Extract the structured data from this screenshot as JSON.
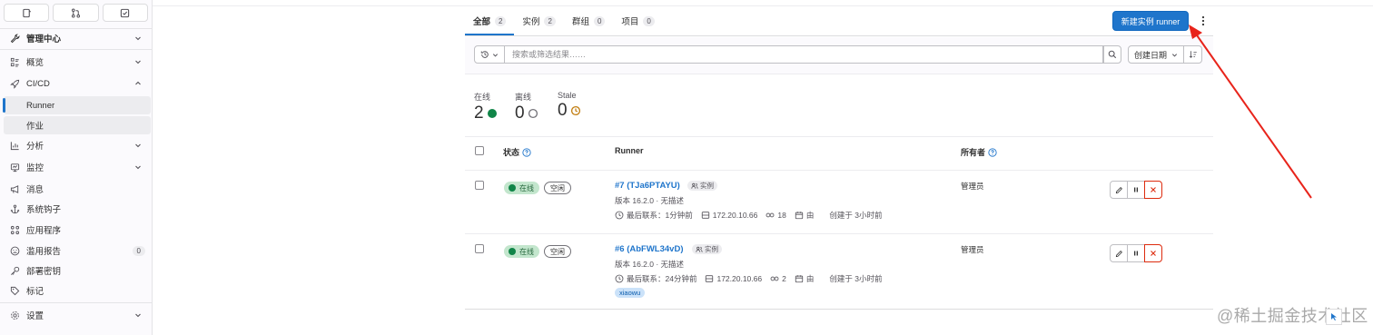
{
  "sidebar": {
    "admin_title": "管理中心",
    "items": [
      {
        "label": "概览",
        "icon": "overview-icon",
        "chevron": true
      },
      {
        "label": "CI/CD",
        "icon": "rocket-icon",
        "chevron": true
      },
      {
        "label": "Runner",
        "sub": true,
        "active": true
      },
      {
        "label": "作业",
        "sub": true
      },
      {
        "label": "分析",
        "icon": "chart-icon",
        "chevron": true
      },
      {
        "label": "监控",
        "icon": "monitor-icon",
        "chevron": true
      },
      {
        "label": "消息",
        "icon": "bullhorn-icon"
      },
      {
        "label": "系统钩子",
        "icon": "hook-icon"
      },
      {
        "label": "应用程序",
        "icon": "apps-icon"
      },
      {
        "label": "滥用报告",
        "icon": "abuse-icon",
        "count": "0"
      },
      {
        "label": "部署密钥",
        "icon": "key-icon"
      },
      {
        "label": "标记",
        "icon": "label-icon"
      },
      {
        "label": "设置",
        "icon": "settings-icon",
        "chevron": true
      }
    ]
  },
  "tabs": [
    {
      "label": "全部",
      "count": "2",
      "active": true
    },
    {
      "label": "实例",
      "count": "2"
    },
    {
      "label": "群组",
      "count": "0"
    },
    {
      "label": "项目",
      "count": "0"
    }
  ],
  "new_runner_label": "新建实例 runner",
  "search": {
    "placeholder": "搜索或筛选结果……"
  },
  "sort": {
    "label": "创建日期"
  },
  "stats": [
    {
      "label": "在线",
      "value": "2",
      "kind": "online"
    },
    {
      "label": "离线",
      "value": "0",
      "kind": "offline"
    },
    {
      "label": "Stale",
      "value": "0",
      "kind": "stale"
    }
  ],
  "table": {
    "headers": {
      "status": "状态",
      "runner": "Runner",
      "owner": "所有者"
    },
    "rows": [
      {
        "status": "在线",
        "idle": "空闲",
        "title": "#7 (TJa6PTAYU)",
        "type": "实例",
        "version": "版本 16.2.0 · 无描述",
        "last_contact": "最后联系：1分钟前",
        "ip": "172.20.10.66",
        "jobs": "18",
        "by": "由",
        "created": "创建于 3小时前",
        "owner": "管理员",
        "tags": []
      },
      {
        "status": "在线",
        "idle": "空闲",
        "title": "#6 (AbFWL34vD)",
        "type": "实例",
        "version": "版本 16.2.0 · 无描述",
        "last_contact": "最后联系：24分钟前",
        "ip": "172.20.10.66",
        "jobs": "2",
        "by": "由",
        "created": "创建于 3小时前",
        "owner": "管理员",
        "tags": [
          "xiaowu"
        ]
      }
    ]
  },
  "watermark": "@稀土掘金技术社区",
  "colors": {
    "accent": "#1f75cb",
    "online": "#108548",
    "danger": "#dd2b0e",
    "annotation_arrow": "#e8241b"
  }
}
